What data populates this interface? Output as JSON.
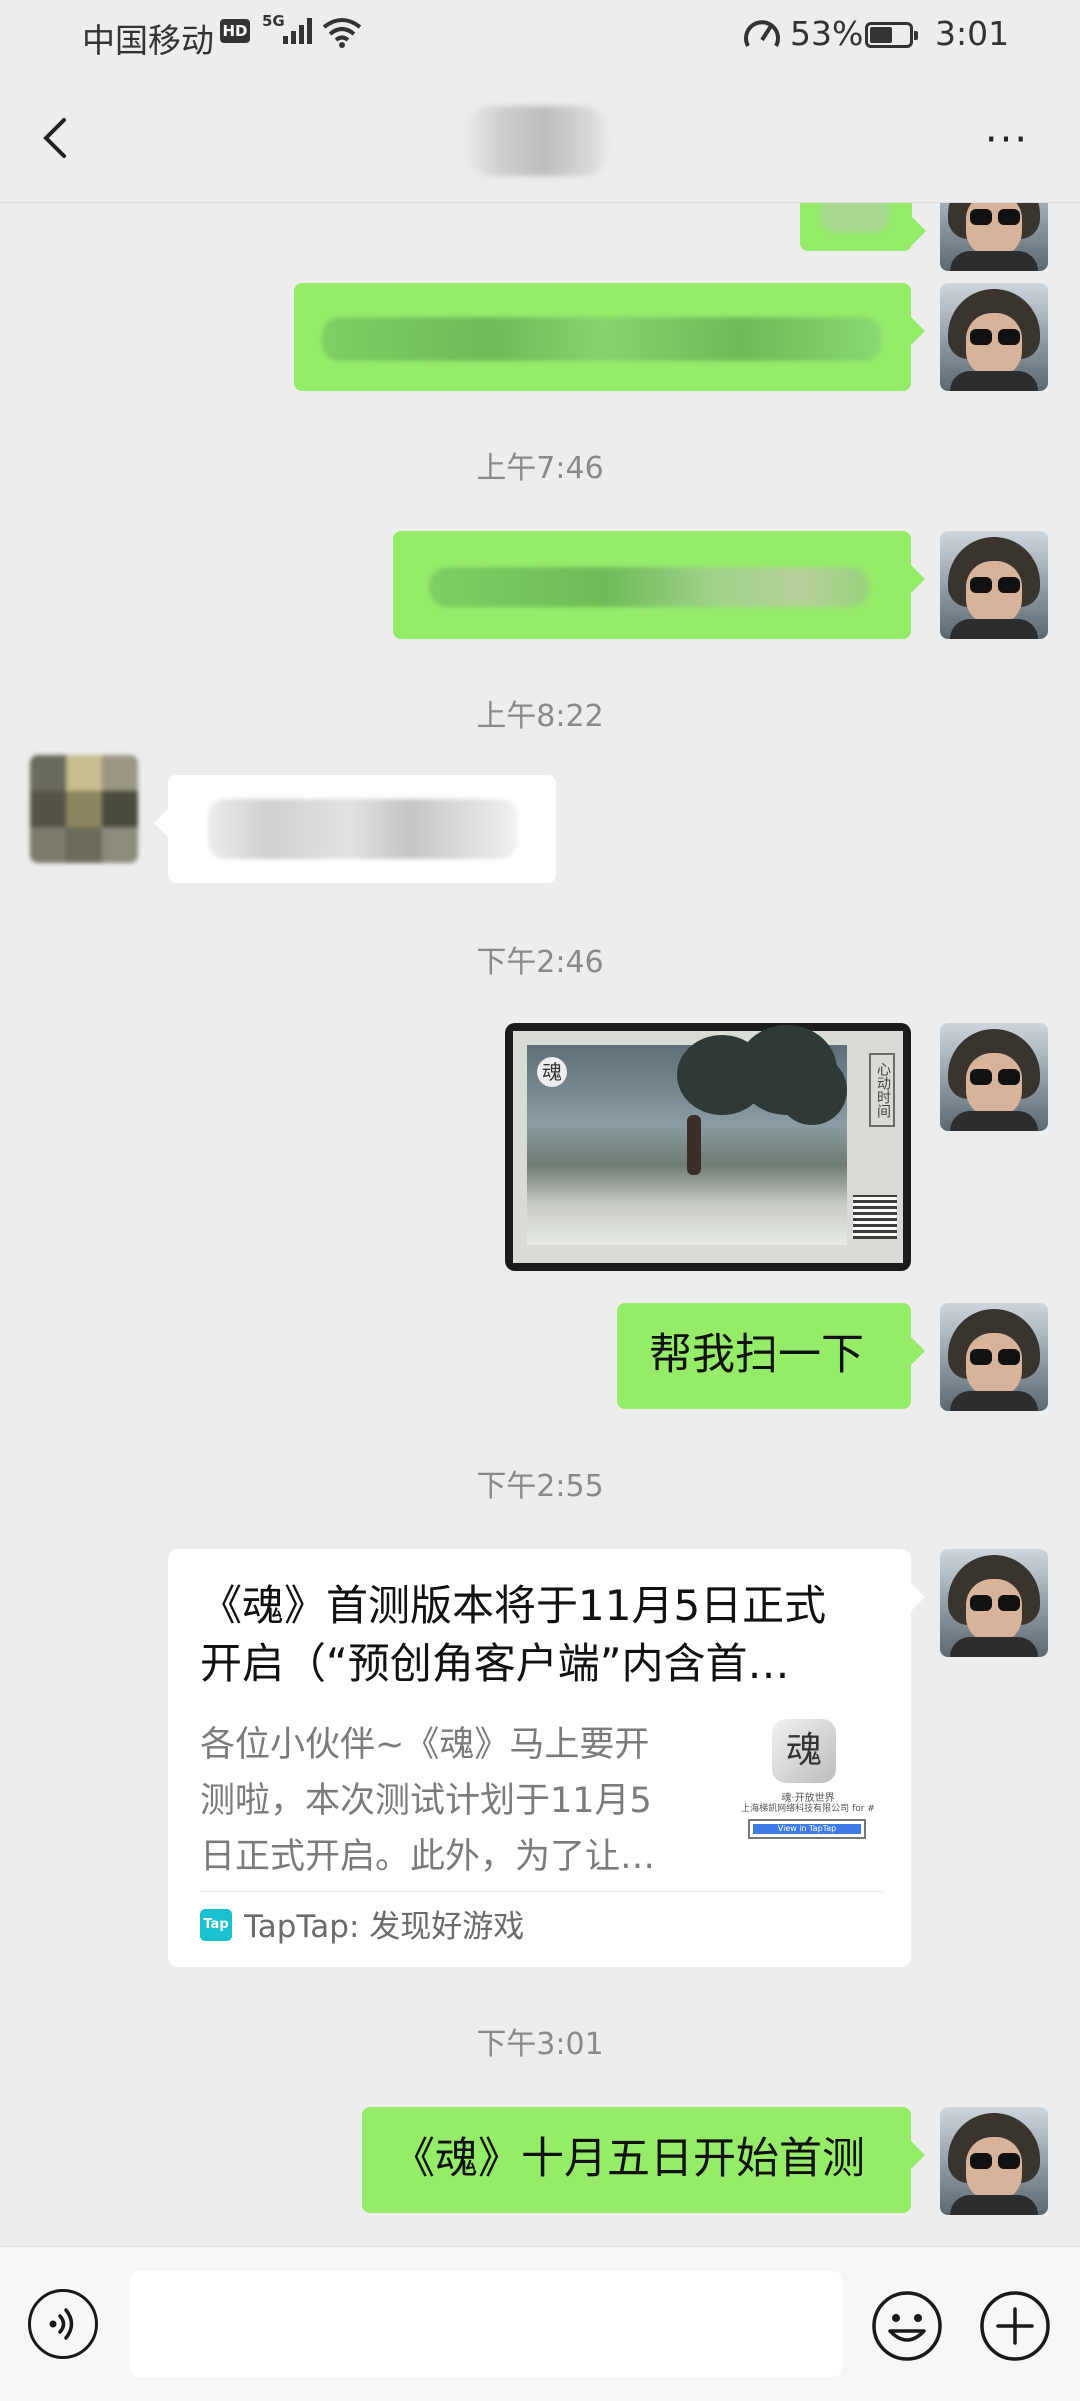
{
  "status_bar": {
    "carrier": "中国移动",
    "hd": "HD",
    "network": "5G",
    "battery_percent": "53%",
    "battery_level": 0.53,
    "time": "3:01"
  },
  "header": {
    "back_icon": "chevron-left-icon",
    "more_icon": "more-dots-icon",
    "more_label": "···"
  },
  "messages": {
    "t1": "上午7:46",
    "t2": "上午8:22",
    "t3": "下午2:46",
    "text1": "帮我扫一下",
    "t4": "下午2:55",
    "t5": "下午3:01",
    "text2": "《魂》十月五日开始首测"
  },
  "image_message": {
    "logo_text": "魂",
    "seal_text": "心动时间"
  },
  "link_card": {
    "title_line1": "《魂》首测版本将于11月5日正式",
    "title_line2": "开启（“预创角客户端”内含首…",
    "desc_line1": "各位小伙伴~《魂》马上要开",
    "desc_line2": "测啦，本次测试计划于11月5",
    "desc_line3": "日正式开启。此外，为了让…",
    "source_icon_label": "Tap",
    "source": "TapTap: 发现好游戏",
    "thumb_app": "魂",
    "thumb_line1": "魂·开放世界",
    "thumb_line2": "上海梯凯网络科技有限公司 for #",
    "thumb_button": "View in TapTap"
  },
  "bottom_bar": {
    "voice_icon": "voice-icon",
    "emoji_icon": "emoji-icon",
    "plus_icon": "plus-icon"
  }
}
